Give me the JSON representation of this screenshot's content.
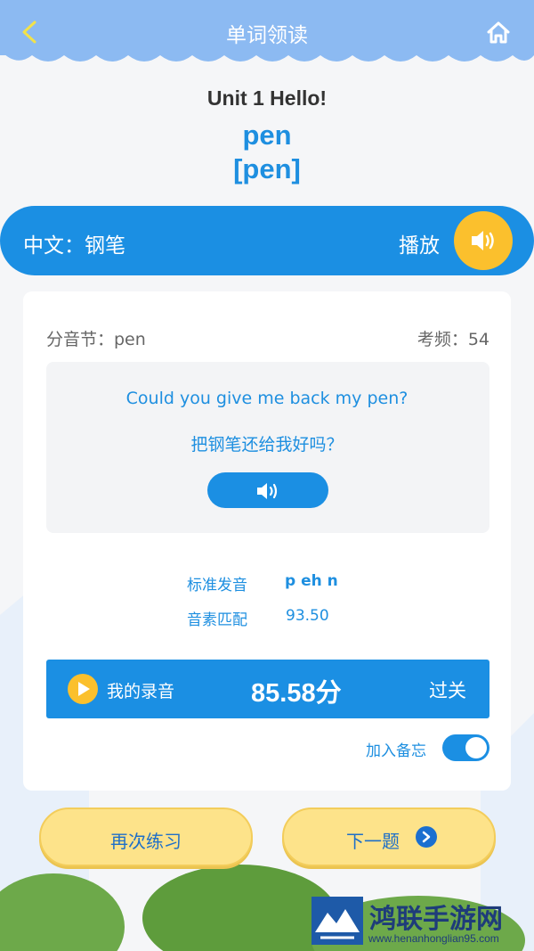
{
  "header": {
    "title": "单词领读"
  },
  "lesson": {
    "unit_title": "Unit 1 Hello!",
    "word": "pen",
    "phonetic": "[pen]"
  },
  "meaning": {
    "text": "中文：钢笔",
    "play_label": "播放"
  },
  "card": {
    "syllable": "分音节：pen",
    "frequency": "考频：54",
    "example_en": "Could you give me back my pen?",
    "example_cn": "把钢笔还给我好吗？",
    "std_label": "标准发音",
    "std_value": "p eh n",
    "phoneme_label": "音素匹配",
    "phoneme_value": "93.50",
    "record_label": "我的录音",
    "record_score": "85.58分",
    "record_result": "过关",
    "memo_label": "加入备忘",
    "memo_on": true
  },
  "buttons": {
    "again": "再次练习",
    "next": "下一题"
  },
  "watermark": {
    "title": "鸿联手游网",
    "url": "www.henanhonglian95.com"
  },
  "colors": {
    "primary": "#1b8fe3",
    "accent": "#fbc02d",
    "header": "#8cbaf2",
    "button": "#fde38a"
  }
}
